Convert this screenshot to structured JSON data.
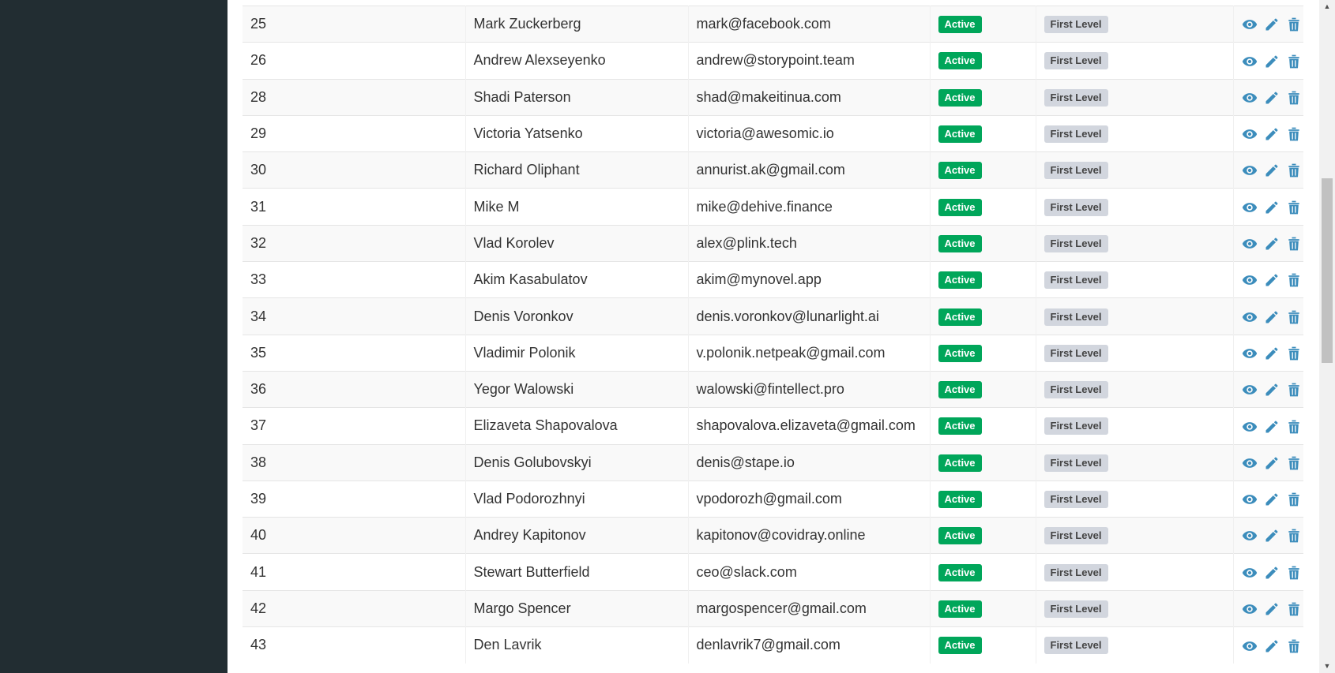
{
  "colors": {
    "sidebar_bg": "#222d32",
    "active_badge": "#00a65a",
    "level_badge": "#d2d6de",
    "action_icon": "#3c8dbc"
  },
  "table": {
    "rows": [
      {
        "id": "25",
        "name": "Mark Zuckerberg",
        "email": "mark@facebook.com",
        "status": "Active",
        "level": "First Level"
      },
      {
        "id": "26",
        "name": "Andrew Alexseyenko",
        "email": "andrew@storypoint.team",
        "status": "Active",
        "level": "First Level"
      },
      {
        "id": "28",
        "name": "Shadi Paterson",
        "email": "shad@makeitinua.com",
        "status": "Active",
        "level": "First Level"
      },
      {
        "id": "29",
        "name": "Victoria Yatsenko",
        "email": "victoria@awesomic.io",
        "status": "Active",
        "level": "First Level"
      },
      {
        "id": "30",
        "name": "Richard Oliphant",
        "email": "annurist.ak@gmail.com",
        "status": "Active",
        "level": "First Level"
      },
      {
        "id": "31",
        "name": "Mike M",
        "email": "mike@dehive.finance",
        "status": "Active",
        "level": "First Level"
      },
      {
        "id": "32",
        "name": "Vlad Korolev",
        "email": "alex@plink.tech",
        "status": "Active",
        "level": "First Level"
      },
      {
        "id": "33",
        "name": "Akim Kasabulatov",
        "email": "akim@mynovel.app",
        "status": "Active",
        "level": "First Level"
      },
      {
        "id": "34",
        "name": "Denis Voronkov",
        "email": "denis.voronkov@lunarlight.ai",
        "status": "Active",
        "level": "First Level"
      },
      {
        "id": "35",
        "name": "Vladimir Polonik",
        "email": "v.polonik.netpeak@gmail.com",
        "status": "Active",
        "level": "First Level"
      },
      {
        "id": "36",
        "name": "Yegor Walowski",
        "email": "walowski@fintellect.pro",
        "status": "Active",
        "level": "First Level"
      },
      {
        "id": "37",
        "name": "Elizaveta Shapovalova",
        "email": "shapovalova.elizaveta@gmail.com",
        "status": "Active",
        "level": "First Level"
      },
      {
        "id": "38",
        "name": "Denis Golubovskyi",
        "email": "denis@stape.io",
        "status": "Active",
        "level": "First Level"
      },
      {
        "id": "39",
        "name": "Vlad Podorozhnyi",
        "email": "vpodorozh@gmail.com",
        "status": "Active",
        "level": "First Level"
      },
      {
        "id": "40",
        "name": "Andrey Kapitonov",
        "email": "kapitonov@covidray.online",
        "status": "Active",
        "level": "First Level"
      },
      {
        "id": "41",
        "name": "Stewart Butterfield",
        "email": "ceo@slack.com",
        "status": "Active",
        "level": "First Level"
      },
      {
        "id": "42",
        "name": "Margo Spencer",
        "email": "margospencer@gmail.com",
        "status": "Active",
        "level": "First Level"
      },
      {
        "id": "43",
        "name": "Den Lavrik",
        "email": "denlavrik7@gmail.com",
        "status": "Active",
        "level": "First Level"
      }
    ],
    "actions": [
      "eye-icon",
      "pencil-icon",
      "trash-icon"
    ]
  }
}
